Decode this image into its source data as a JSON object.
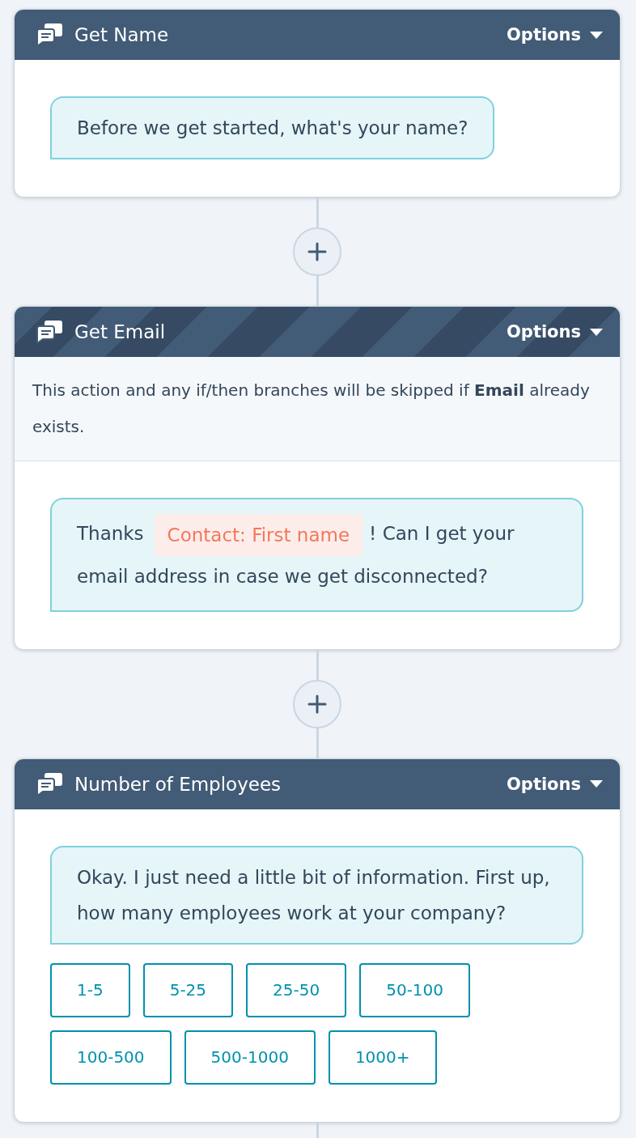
{
  "flow": {
    "steps": [
      {
        "title": "Get Name",
        "options_label": "Options",
        "skip_if_exists": false,
        "message": [
          {
            "kind": "text",
            "text": "Before we get started, what's your name?"
          }
        ]
      },
      {
        "title": "Get Email",
        "options_label": "Options",
        "skip_if_exists": true,
        "notice": "This action and any if/then branches will be skipped if **Email** already exists.",
        "message": [
          {
            "kind": "text",
            "text": "Thanks"
          },
          {
            "kind": "token",
            "text": "Contact: First name"
          },
          {
            "kind": "text",
            "text": "! Can I get your email address in case we get disconnected?"
          }
        ]
      },
      {
        "title": "Number of Employees",
        "options_label": "Options",
        "skip_if_exists": false,
        "message": [
          {
            "kind": "text",
            "text": "Okay. I just need a little bit of information. First up, how many employees work at your company?"
          }
        ],
        "choices": [
          "1-5",
          "5-25",
          "25-50",
          "50-100",
          "100-500",
          "500-1000",
          "1000+"
        ]
      }
    ]
  }
}
